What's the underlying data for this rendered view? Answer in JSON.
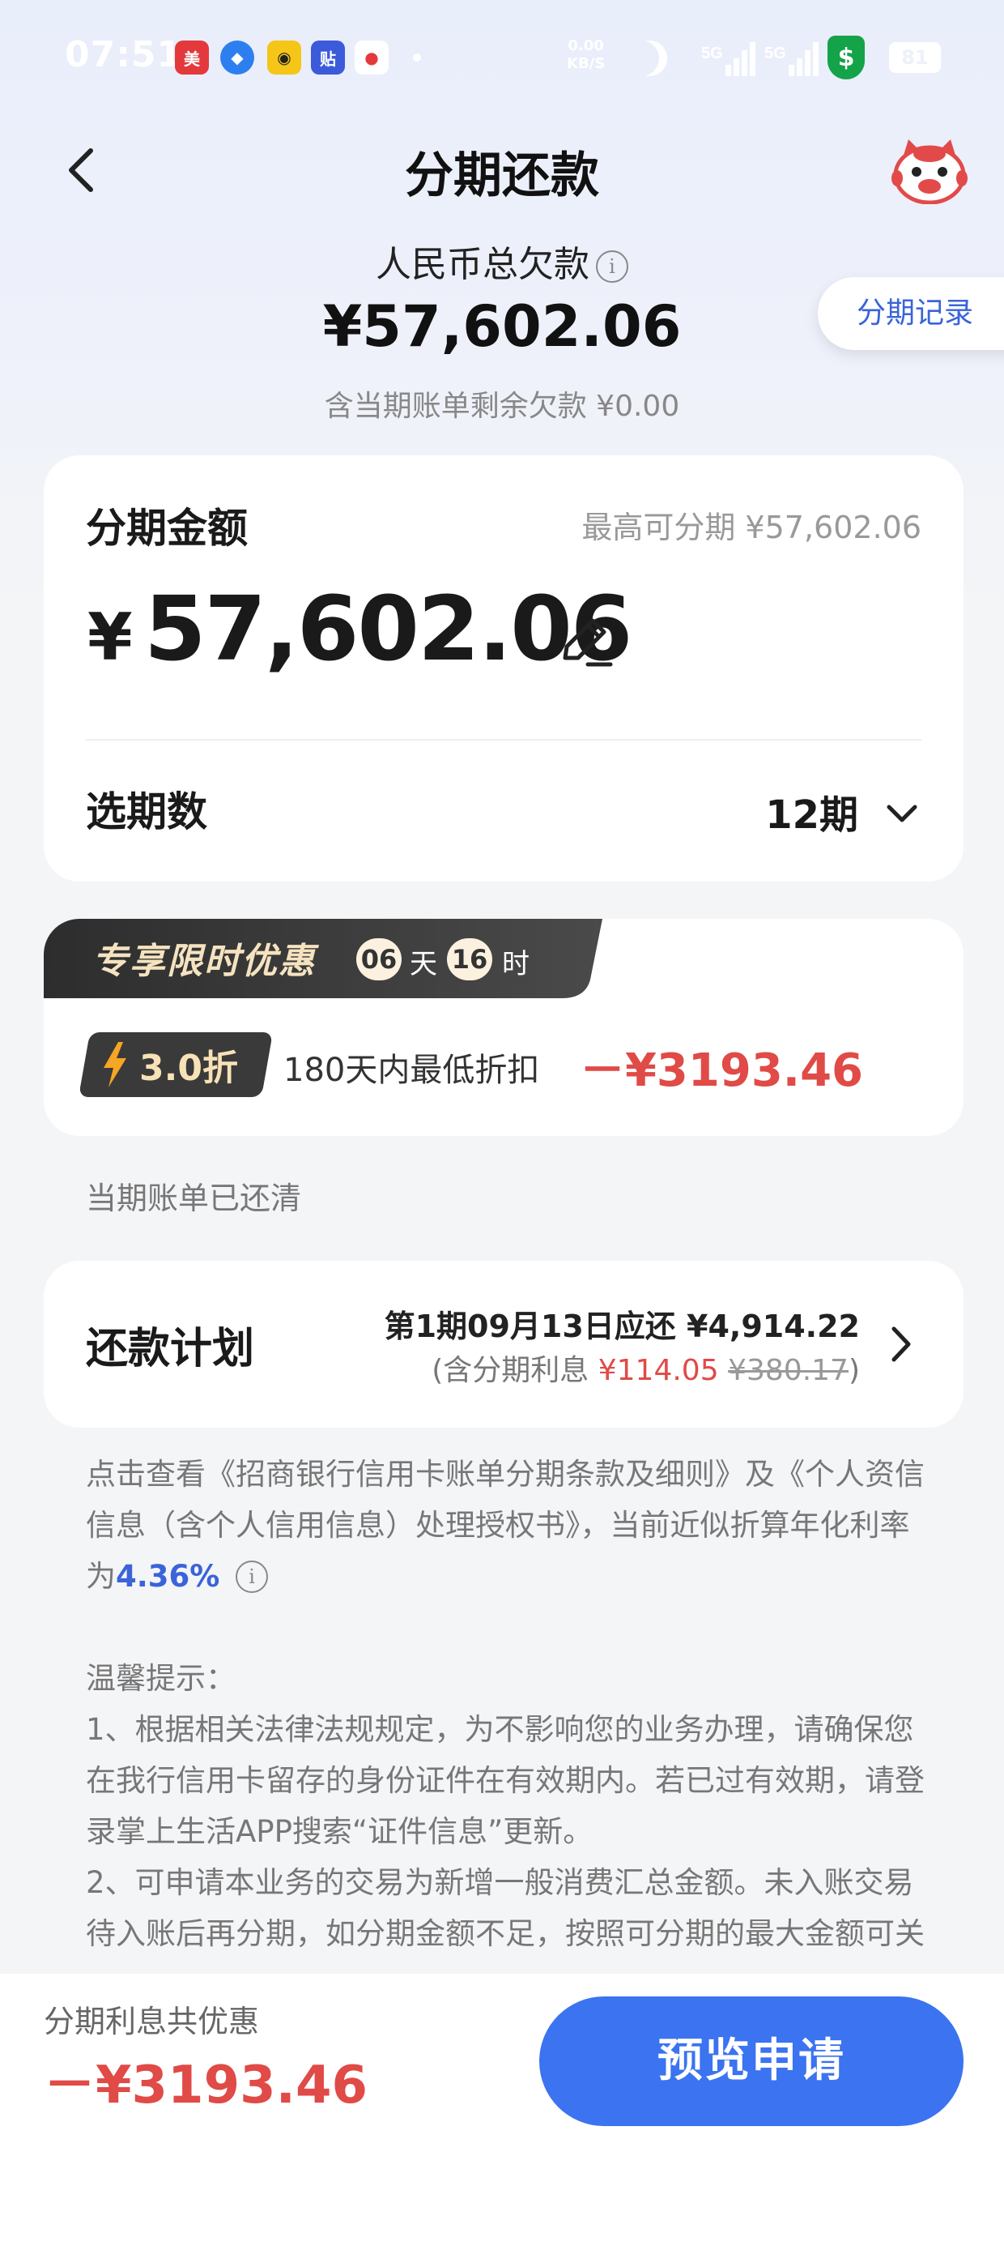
{
  "status_bar": {
    "time": "07:51",
    "net_speed_value": "0.00",
    "net_speed_unit": "KB/S",
    "signal_1": "5G",
    "signal_2": "5G",
    "battery": "81",
    "app_icons": [
      "meituan-app-icon",
      "feather-app-icon",
      "meituan-bike-icon",
      "tieba-app-icon",
      "mobile-app-icon"
    ]
  },
  "header": {
    "title": "分期还款",
    "back_icon": "chevron-left-icon",
    "mascot_icon": "mascot-icon"
  },
  "debt": {
    "label": "人民币总欠款",
    "amount": "¥57,602.06",
    "sub": "含当期账单剩余欠款 ¥0.00"
  },
  "records_button": "分期记录",
  "amount_card": {
    "label": "分期金额",
    "max": "最高可分期 ¥57,602.06",
    "currency": "¥",
    "amount": "57,602.06",
    "select_label": "选期数",
    "selected_period": "12期"
  },
  "promo": {
    "title": "专享限时优惠",
    "days": "06",
    "day_unit": "天",
    "hours": "16",
    "hour_unit": "时",
    "discount": "3.0折",
    "description": "180天内最低折扣",
    "saving": "－¥3193.46"
  },
  "bill_status": "当期账单已还清",
  "plan": {
    "label": "还款计划",
    "line1": "第1期09月13日应还 ¥4,914.22",
    "line2_prefix": "(含分期利息 ",
    "interest": "¥114.05",
    "original_interest": "¥380.17",
    "line2_suffix": ")"
  },
  "terms": {
    "text": "点击查看《招商银行信用卡账单分期条款及细则》及《个人资信信息（含个人信用信息）处理授权书》，当前近似折算年化利率为",
    "rate": "4.36%"
  },
  "tips": {
    "title": "温馨提示：",
    "item1": "1、根据相关法律法规规定，为不影响您的业务办理，请确保您在我行信用卡留存的身份证件在有效期内。若已过有效期，请登录掌上生活APP搜索“证件信息”更新。",
    "item2": "2、可申请本业务的交易为新增一般消费汇总金额。未入账交易待入账后再分期，如分期金额不足，按照可分期的最大金额可关"
  },
  "bottom": {
    "label": "分期利息共优惠",
    "amount": "－¥3193.46",
    "button": "预览申请"
  },
  "colors": {
    "accent_blue": "#3b73f0",
    "discount_red": "#e04a47"
  }
}
